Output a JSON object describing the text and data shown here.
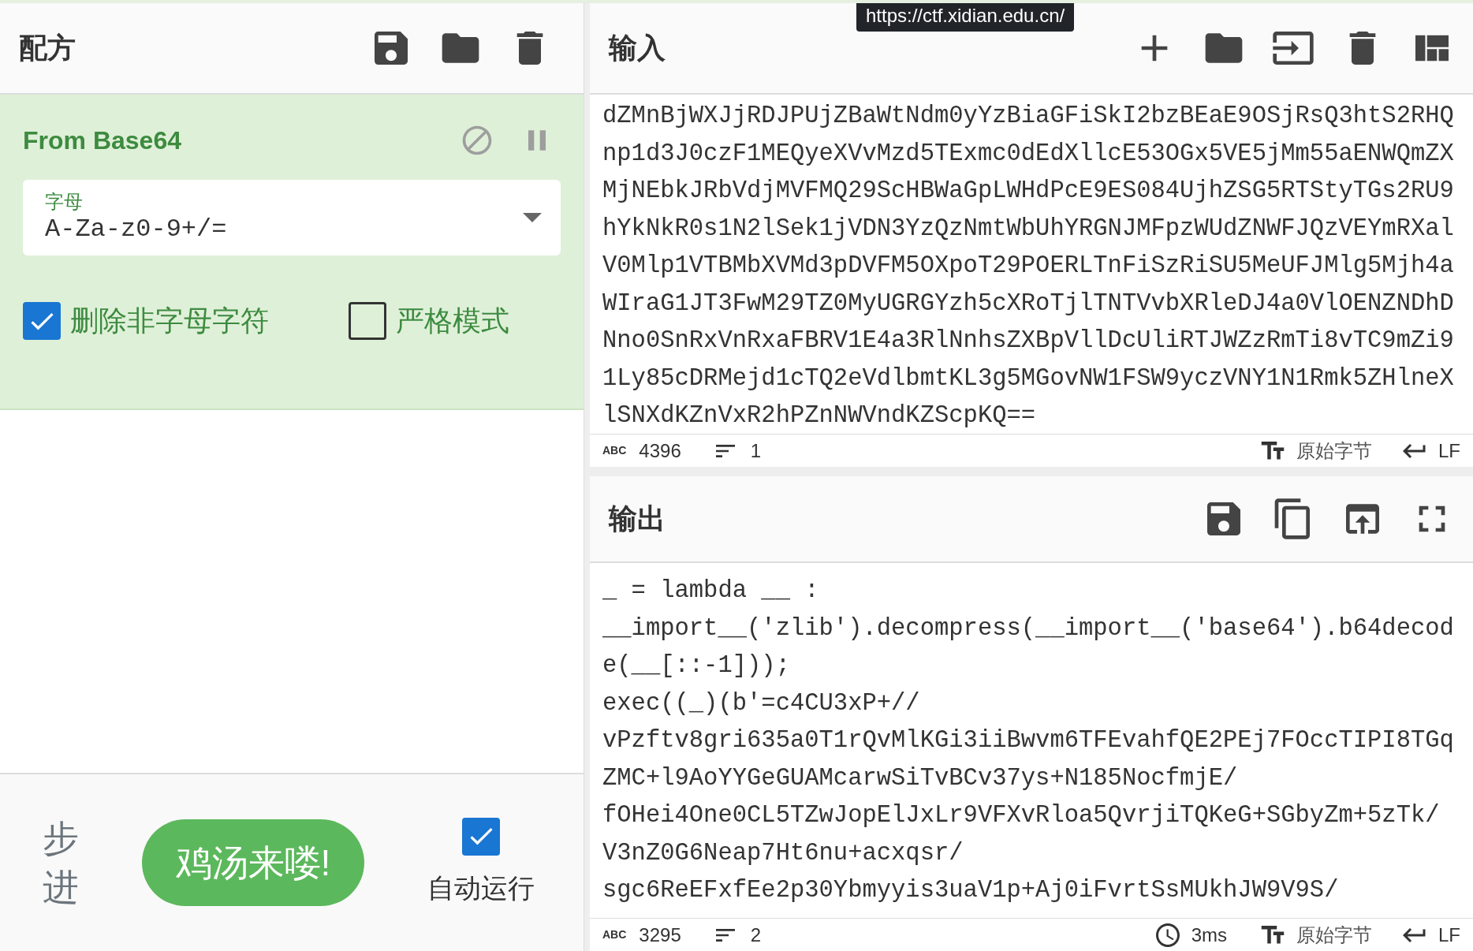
{
  "tooltip": "https://ctf.xidian.edu.cn/",
  "recipe": {
    "title": "配方",
    "operation": {
      "name": "From Base64",
      "dropdown": {
        "label": "字母",
        "value": "A-Za-z0-9+/="
      },
      "checkboxes": [
        {
          "label": "删除非字母字符",
          "checked": true
        },
        {
          "label": "严格模式",
          "checked": false
        }
      ]
    },
    "step_label": "步进",
    "bake_button": "鸡汤来喽!",
    "auto_bake": {
      "label": "自动运行",
      "checked": true
    }
  },
  "input": {
    "title": "输入",
    "lines": [
      "dZMnBjWXJjRDJPUjZBaWtNdm0yYzBiaGFiSkI2bzBEaE9OSjRsQ3htS2RHQ",
      "np1d3J0czF1MEQyeXVvMzd5TExmc0dEdXllcE53OGx5VE5jMm55aENWQmZX",
      "MjNEbkJRbVdjMVFMQ29ScHBWaGpLWHdPcE9ES084UjhZSG5RTStyTGs2RU9",
      "hYkNkR0s1N2lSek1jVDN3YzQzNmtWbUhYRGNJMFpzWUdZNWFJQzVEYmRXal",
      "V0Mlp1VTBMbXVMd3pDVFM5OXpoT29POERLTnFiSzRiSU5MeUFJMlg5Mjh4a",
      "WIraG1JT3FwM29TZ0MyUGRGYzh5cXRoTjlTNTVvbXRleDJ4a0VlOENZNDhD",
      "Nno0SnRxVnRxaFBRV1E4a3RlNnhsZXBpVllDcUliRTJWZzRmTi8vTC9mZi9",
      "1Ly85cDRMejd1cTQ2eVdlbmtKL3g5MGovNW1FSW9yczVNY1N1Rmk5ZHlneX",
      "lSNXdKZnVxR2hPZnNWVndKZScpKQ=="
    ],
    "status": {
      "abc": "ABC",
      "length": "4396",
      "lines": "1",
      "encoding": "原始字节",
      "eol": "LF"
    }
  },
  "output": {
    "title": "输出",
    "lines": [
      "_ = lambda __ :",
      "__import__('zlib').decompress(__import__('base64').b64decod",
      "e(__[::-1]));",
      "exec((_)(b'=c4CU3xP+//",
      "vPzftv8gri635a0T1rQvMlKGi3iiBwvm6TFEvahfQE2PEj7FOccTIPI8TGq",
      "ZMC+l9AoYYGeGUAMcarwSiTvBCv37ys+N185NocfmjE/",
      "fOHei4One0CL5TZwJopElJxLr9VFXvRloa5QvrjiTQKeG+SGbyZm+5zTk/",
      "V3nZ0G6Neap7Ht6nu+acxqsr/",
      "sgc6ReEFxfEe2p30Ybmyyis3uaV1p+Aj0iFvrtSsMUkhJW9V9S/"
    ],
    "status": {
      "abc": "ABC",
      "length": "3295",
      "lines": "2",
      "time": "3ms",
      "encoding": "原始字节",
      "eol": "LF"
    }
  }
}
